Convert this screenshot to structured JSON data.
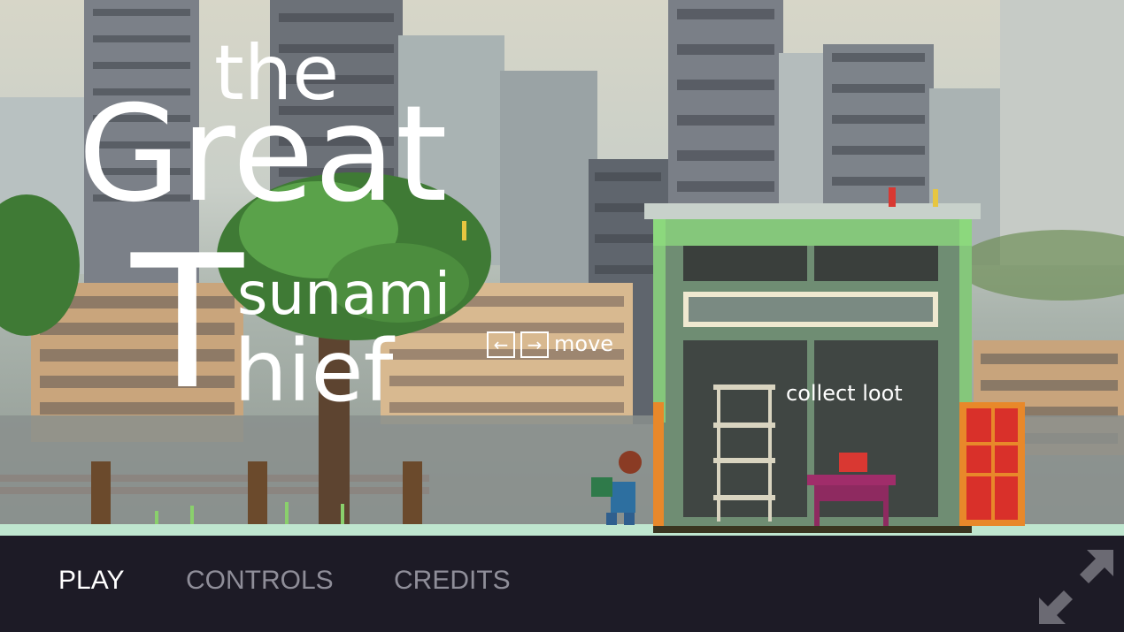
{
  "title": {
    "line1": "the",
    "line2": "Great",
    "line3": "sunami",
    "line4": "hief",
    "initial": "T"
  },
  "hints": {
    "move": "move",
    "left_key": "←",
    "right_key": "→",
    "collect": "collect loot"
  },
  "menu": {
    "play": "PLAY",
    "controls": "CONTROLS",
    "credits": "CREDITS"
  },
  "icons": {
    "fullscreen": "fullscreen-icon"
  },
  "colors": {
    "menu_bg": "#1d1b26",
    "menu_active": "#ffffff",
    "menu_inactive": "#8f8e99",
    "door": "#d9302a",
    "house_frame": "#6f8d73",
    "vines": "#8ee07f"
  }
}
